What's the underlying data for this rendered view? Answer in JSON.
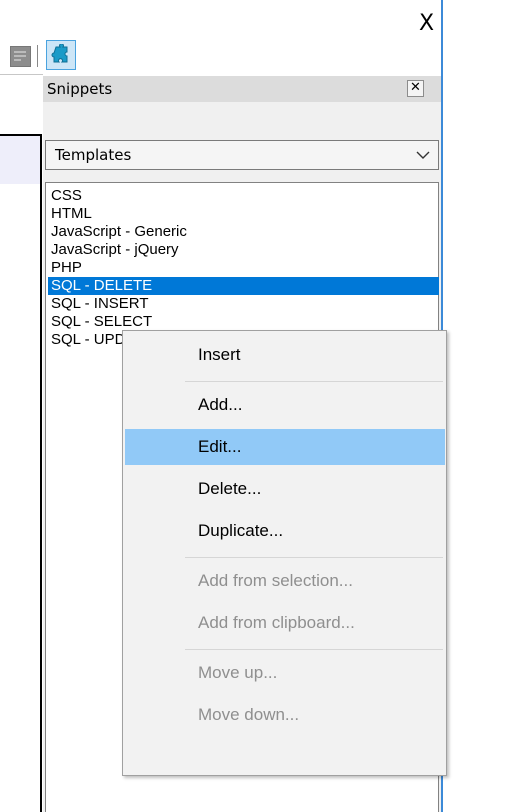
{
  "window": {
    "close_label": "X"
  },
  "panel": {
    "title": "Snippets",
    "close_glyph": "✕",
    "dropdown_value": "Templates"
  },
  "list": {
    "items": [
      "CSS",
      "HTML",
      "JavaScript - Generic",
      "JavaScript - jQuery",
      "PHP",
      "SQL - DELETE",
      "SQL - INSERT",
      "SQL - SELECT",
      "SQL - UPDATE"
    ],
    "selected": "SQL - DELETE"
  },
  "context_menu": {
    "items": [
      {
        "label": "Insert"
      },
      {
        "label": "Add..."
      },
      {
        "label": "Edit..."
      },
      {
        "label": "Delete..."
      },
      {
        "label": "Duplicate..."
      },
      {
        "label": "Add from selection..."
      },
      {
        "label": "Add from clipboard..."
      },
      {
        "label": "Move up..."
      },
      {
        "label": "Move down..."
      }
    ],
    "hovered": "Edit..."
  },
  "colors": {
    "selection": "#0078d7",
    "hover": "#91c9f7",
    "accent_line": "#3c8ad8",
    "disabled_text": "#8f8f8f"
  },
  "icons": {
    "toolbar": [
      "document-list-icon",
      "puzzle-piece-icon"
    ],
    "dropdown": "chevron-down-icon",
    "panel_close": "close-icon"
  }
}
